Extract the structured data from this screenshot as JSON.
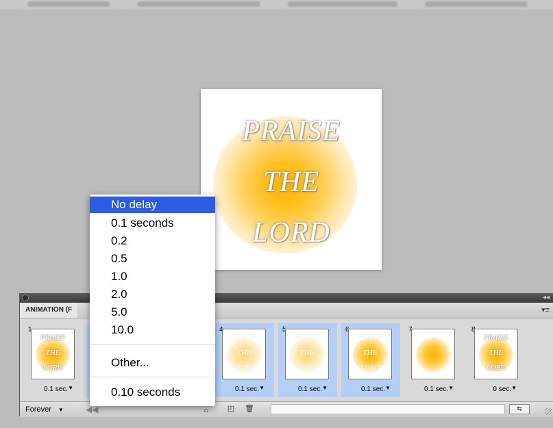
{
  "artwork": {
    "lines": [
      "PRAISE",
      "THE",
      "LORD"
    ]
  },
  "panel": {
    "tab_label": "ANIMATION (F",
    "menu_icon": "panel-menu-icon",
    "frames": [
      {
        "number": "1",
        "delay": "0.1 sec.",
        "selected": false,
        "thumb_text": [
          "PRAISE",
          "THE",
          "LORD"
        ]
      },
      {
        "number": "4",
        "delay": "0.1 sec.",
        "selected": true,
        "thumb_text": [
          "PRAISE",
          "THE",
          "LORD"
        ]
      },
      {
        "number": "5",
        "delay": "0.1 sec.",
        "selected": true,
        "thumb_text": [
          "PRAISE",
          "THE",
          "LORD"
        ]
      },
      {
        "number": "6",
        "delay": "0.1 sec.",
        "selected": true,
        "thumb_text": [
          "PRAISE",
          "THE",
          "LORD"
        ]
      },
      {
        "number": "7",
        "delay": "0.1 sec.",
        "selected": false,
        "thumb_text": []
      },
      {
        "number": "8",
        "delay": "0 sec.",
        "selected": false,
        "thumb_text": [
          "PRAISE",
          "THE",
          "LORD"
        ]
      }
    ],
    "loop": "Forever"
  },
  "delay_menu": {
    "items": [
      "No delay",
      "0.1 seconds",
      "0.2",
      "0.5",
      "1.0",
      "2.0",
      "5.0",
      "10.0"
    ],
    "other": "Other...",
    "current": "0.10 seconds",
    "highlighted": "No delay"
  }
}
